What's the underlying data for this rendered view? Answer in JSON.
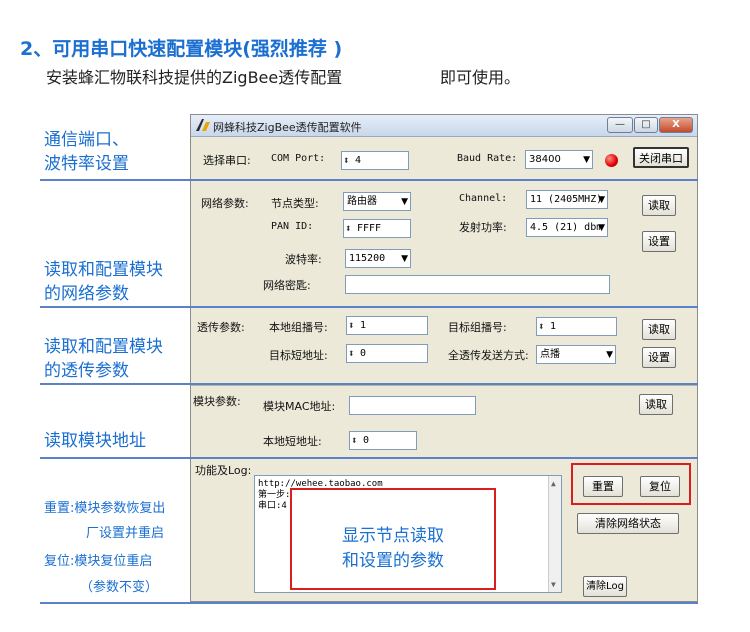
{
  "heading": {
    "title": "2、可用串口快速配置模块(强烈推荐 )",
    "subtitle": "安装蜂汇物联科技提供的ZigBee透传配置",
    "subtitle2": "即可使用。"
  },
  "side_labels": {
    "serial": [
      "通信端口、",
      "波特率设置"
    ],
    "network": [
      "读取和配置模块",
      "的网络参数"
    ],
    "transparent": [
      "读取和配置模块",
      "的透传参数"
    ],
    "address": "读取模块地址",
    "reset": [
      "重置:模块参数恢复出",
      "厂设置并重启",
      "复位:模块复位重启",
      "（参数不变）"
    ]
  },
  "window": {
    "title": "网蜂科技ZigBee透传配置软件",
    "buttons": {
      "minimize": "—",
      "maximize": "□",
      "close": "X"
    }
  },
  "serial": {
    "select_port_label": "选择串口:",
    "com_port_label": "COM Port:",
    "com_port_value": "4",
    "baud_label": "Baud Rate:",
    "baud_value": "38400",
    "close_port_button": "关闭串口",
    "status_color": "#e00000"
  },
  "network": {
    "section_label": "网络参数:",
    "node_type_label": "节点类型:",
    "node_type_value": "路由器",
    "channel_label": "Channel:",
    "channel_value": "11 (2405MHZ)",
    "pan_id_label": "PAN ID:",
    "pan_id_value": "FFFF",
    "tx_power_label": "发射功率:",
    "tx_power_value": "4.5 (21) dbm",
    "baud_label": "波特率:",
    "baud_value": "115200",
    "key_label": "网络密匙:",
    "key_value": "",
    "read_button": "读取",
    "set_button": "设置"
  },
  "transparent": {
    "section_label": "透传参数:",
    "local_group_label": "本地组播号:",
    "local_group_value": "1",
    "target_group_label": "目标组播号:",
    "target_group_value": "1",
    "target_short_label": "目标短地址:",
    "target_short_value": "0",
    "mode_label": "全透传发送方式:",
    "mode_value": "点播",
    "read_button": "读取",
    "set_button": "设置"
  },
  "module": {
    "section_label": "模块参数:",
    "mac_label": "模块MAC地址:",
    "mac_value": "",
    "short_label": "本地短地址:",
    "short_value": "0",
    "read_button": "读取"
  },
  "log": {
    "section_label": "功能及Log:",
    "lines": [
      "http://wehee.taobao.com",
      "第一步: 配置串口-->打开串口",
      "串口:4 打开成功 : 38400 None-8-1."
    ],
    "reset_button": "重置",
    "reboot_button": "复位",
    "clear_network_button": "清除网络状态",
    "clear_log_button": "清除Log"
  },
  "annotation": [
    "显示节点读取",
    "和设置的参数"
  ],
  "colors": {
    "accent": "#1a6fd0",
    "highlight": "#d81e1e",
    "divider": "#5b82c8"
  }
}
